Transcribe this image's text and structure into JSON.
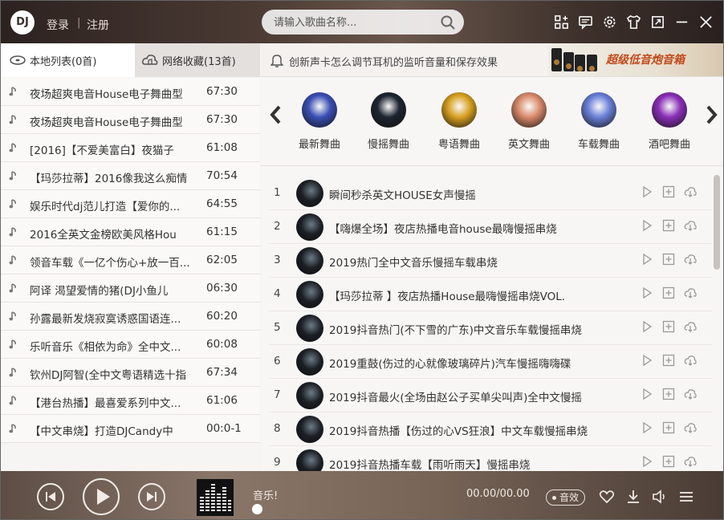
{
  "header": {
    "logo_text": "DJ",
    "login": "登录",
    "separator": "|",
    "register": "注册",
    "search_placeholder": "请输入歌曲名称..."
  },
  "left": {
    "tabs": [
      {
        "label": "本地列表(0首)",
        "icon": "disc-icon"
      },
      {
        "label": "网络收藏(13首)",
        "icon": "cloud-music-icon"
      }
    ],
    "playlist": [
      {
        "name": "夜场超爽电音House电子舞曲型",
        "duration": "67:30"
      },
      {
        "name": "夜场超爽电音House电子舞曲型",
        "duration": "67:30"
      },
      {
        "name": "[2016]【不爱美富白】夜猫子",
        "duration": "61:08"
      },
      {
        "name": "【玛莎拉蒂】2016像我这么痴情",
        "duration": "70:54"
      },
      {
        "name": "娱乐时代dj范儿打造【爱你的...",
        "duration": "64:55"
      },
      {
        "name": "2016全英文金榜欧美风格Hou",
        "duration": "61:15"
      },
      {
        "name": "领音车载《一亿个伤心+放一百...",
        "duration": "62:05"
      },
      {
        "name": "阿译 渴望爱情的猪(DJ小鱼儿",
        "duration": "06:30"
      },
      {
        "name": "孙露最新发烧寂寞诱惑国语连...",
        "duration": "60:20"
      },
      {
        "name": "乐听音乐《相依为命》全中文...",
        "duration": "60:08"
      },
      {
        "name": "钦州DJ阿智(全中文粤语精选十指",
        "duration": "67:34"
      },
      {
        "name": "【港台热播】最喜爱系列中文...",
        "duration": "61:06"
      },
      {
        "name": "【中文串烧】打造DJCandy中",
        "duration": "00:0-1"
      }
    ]
  },
  "right": {
    "notice": "创新声卡怎么调节耳机的监听音量和保存效果",
    "banner_text": "超级低音炮音箱",
    "categories": [
      {
        "label": "最新舞曲",
        "color": "#3a4fb5"
      },
      {
        "label": "慢摇舞曲",
        "color": "#1c2530"
      },
      {
        "label": "粤语舞曲",
        "color": "#d8a020"
      },
      {
        "label": "英文舞曲",
        "color": "#d98a6a"
      },
      {
        "label": "车载舞曲",
        "color": "#6a7fd8"
      },
      {
        "label": "酒吧舞曲",
        "color": "#8a2fb8"
      }
    ],
    "songs": [
      {
        "num": "1",
        "title": "瞬间秒杀英文HOUSE女声慢摇"
      },
      {
        "num": "2",
        "title": "【嗨爆全场】夜店热播电音house最嗨慢摇串烧"
      },
      {
        "num": "3",
        "title": "2019热门全中文音乐慢摇车载串烧"
      },
      {
        "num": "4",
        "title": "【玛莎拉蒂 】夜店热播House最嗨慢摇串烧VOL."
      },
      {
        "num": "5",
        "title": "2019抖音热门(不下雪的广东)中文音乐车载慢摇串烧"
      },
      {
        "num": "6",
        "title": "2019重鼓(伤过的心就像玻璃碎片)汽车慢摇嗨嗨碟"
      },
      {
        "num": "7",
        "title": "2019抖音最火(全场由赵公子买单尖叫声)全中文慢摇"
      },
      {
        "num": "8",
        "title": "2019抖音热播【伤过的心VS狂浪】中文车载慢摇串烧"
      },
      {
        "num": "9",
        "title": "2019抖音热播车载【雨听雨天】慢摇串烧"
      }
    ]
  },
  "player": {
    "now_playing": "音乐!",
    "time": "00.00/00.00",
    "effect_label": "音效"
  }
}
